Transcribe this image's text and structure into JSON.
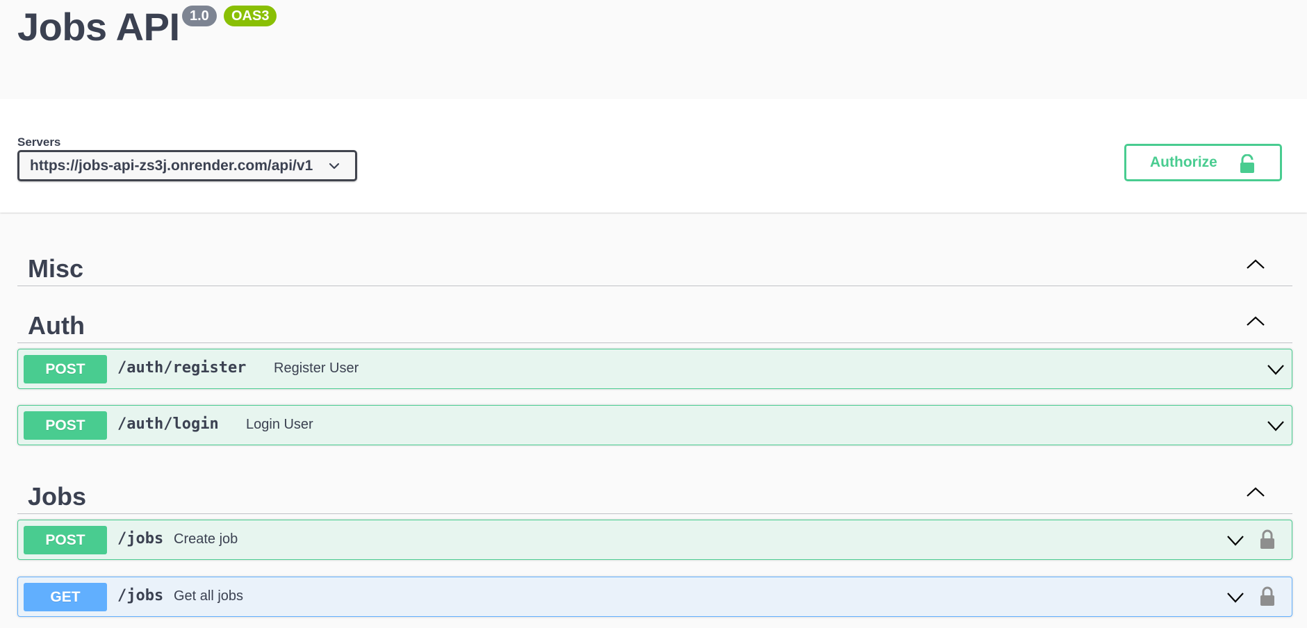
{
  "info": {
    "title": "Jobs API",
    "version": "1.0",
    "oas_badge": "OAS3"
  },
  "servers": {
    "label": "Servers",
    "selected": "https://jobs-api-zs3j.onrender.com/api/v1"
  },
  "authorize": {
    "label": "Authorize",
    "icon": "lock-open-icon"
  },
  "tags": [
    {
      "name": "Misc",
      "expanded": true
    },
    {
      "name": "Auth",
      "expanded": true
    },
    {
      "name": "Jobs",
      "expanded": true
    }
  ],
  "operations": {
    "auth_register": {
      "method": "POST",
      "path": "/auth/register",
      "summary": "Register User",
      "locked": false
    },
    "auth_login": {
      "method": "POST",
      "path": "/auth/login",
      "summary": "Login User",
      "locked": false
    },
    "jobs_create": {
      "method": "POST",
      "path": "/jobs",
      "summary": "Create job",
      "locked": true
    },
    "jobs_get_all": {
      "method": "GET",
      "path": "/jobs",
      "summary": "Get all jobs",
      "locked": true
    }
  },
  "colors": {
    "post": "#49cc90",
    "get": "#61affe",
    "text": "#3b4151",
    "version_badge": "#7d8492",
    "oas_badge": "#89bf04"
  }
}
